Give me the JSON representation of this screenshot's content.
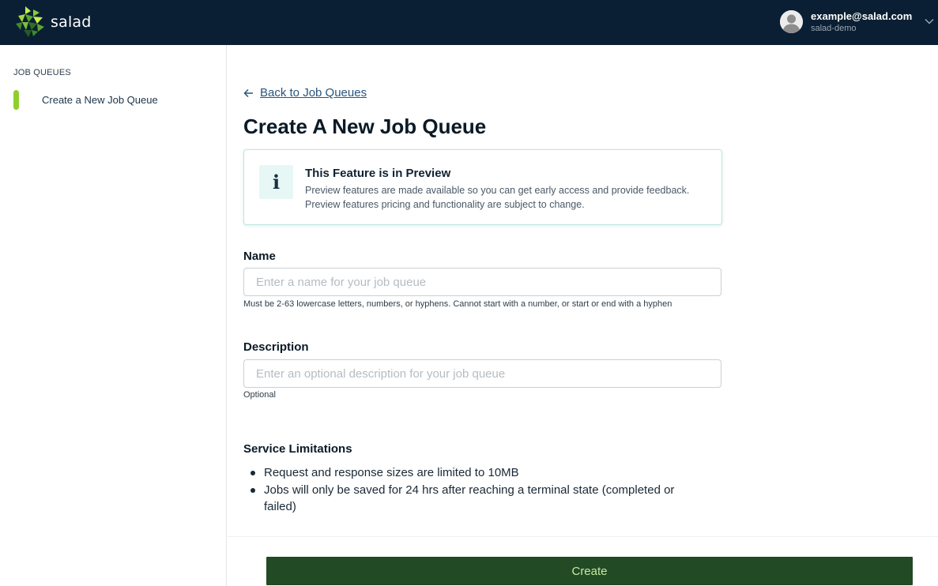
{
  "header": {
    "brand_name": "salad",
    "user_email": "example@salad.com",
    "user_org": "salad-demo",
    "icons": [
      "salad-logo-icon",
      "avatar-icon",
      "chevron-down-icon"
    ]
  },
  "sidebar": {
    "heading": "JOB QUEUES",
    "items": [
      {
        "label": "Create a New Job Queue",
        "active": true
      }
    ]
  },
  "main": {
    "back_link": "Back to Job Queues",
    "title": "Create A New Job Queue",
    "alert": {
      "icon": "info-icon",
      "icon_glyph": "i",
      "title": "This Feature is in Preview",
      "body": "Preview features are made available so you can get early access and provide feedback. Preview features pricing and functionality are subject to change."
    },
    "name_field": {
      "label": "Name",
      "value": "",
      "placeholder": "Enter a name for your job queue",
      "help": "Must be 2-63 lowercase letters, numbers, or hyphens. Cannot start with a number, or start or end with a hyphen"
    },
    "description_field": {
      "label": "Description",
      "value": "",
      "placeholder": "Enter an optional description for your job queue",
      "help": "Optional"
    },
    "limitations": {
      "title": "Service Limitations",
      "items": [
        "Request and response sizes are limited to 10MB",
        "Jobs will only be saved for 24 hrs after reaching a terminal state (completed or failed)"
      ]
    },
    "create_label": "Create"
  },
  "colors": {
    "topbar": "#0a1f33",
    "accent_green": "#8fcf2c",
    "button_bg": "#224a25",
    "button_text": "#c7e8a3",
    "link": "#28557e",
    "alert_border": "#b9e8e1"
  }
}
